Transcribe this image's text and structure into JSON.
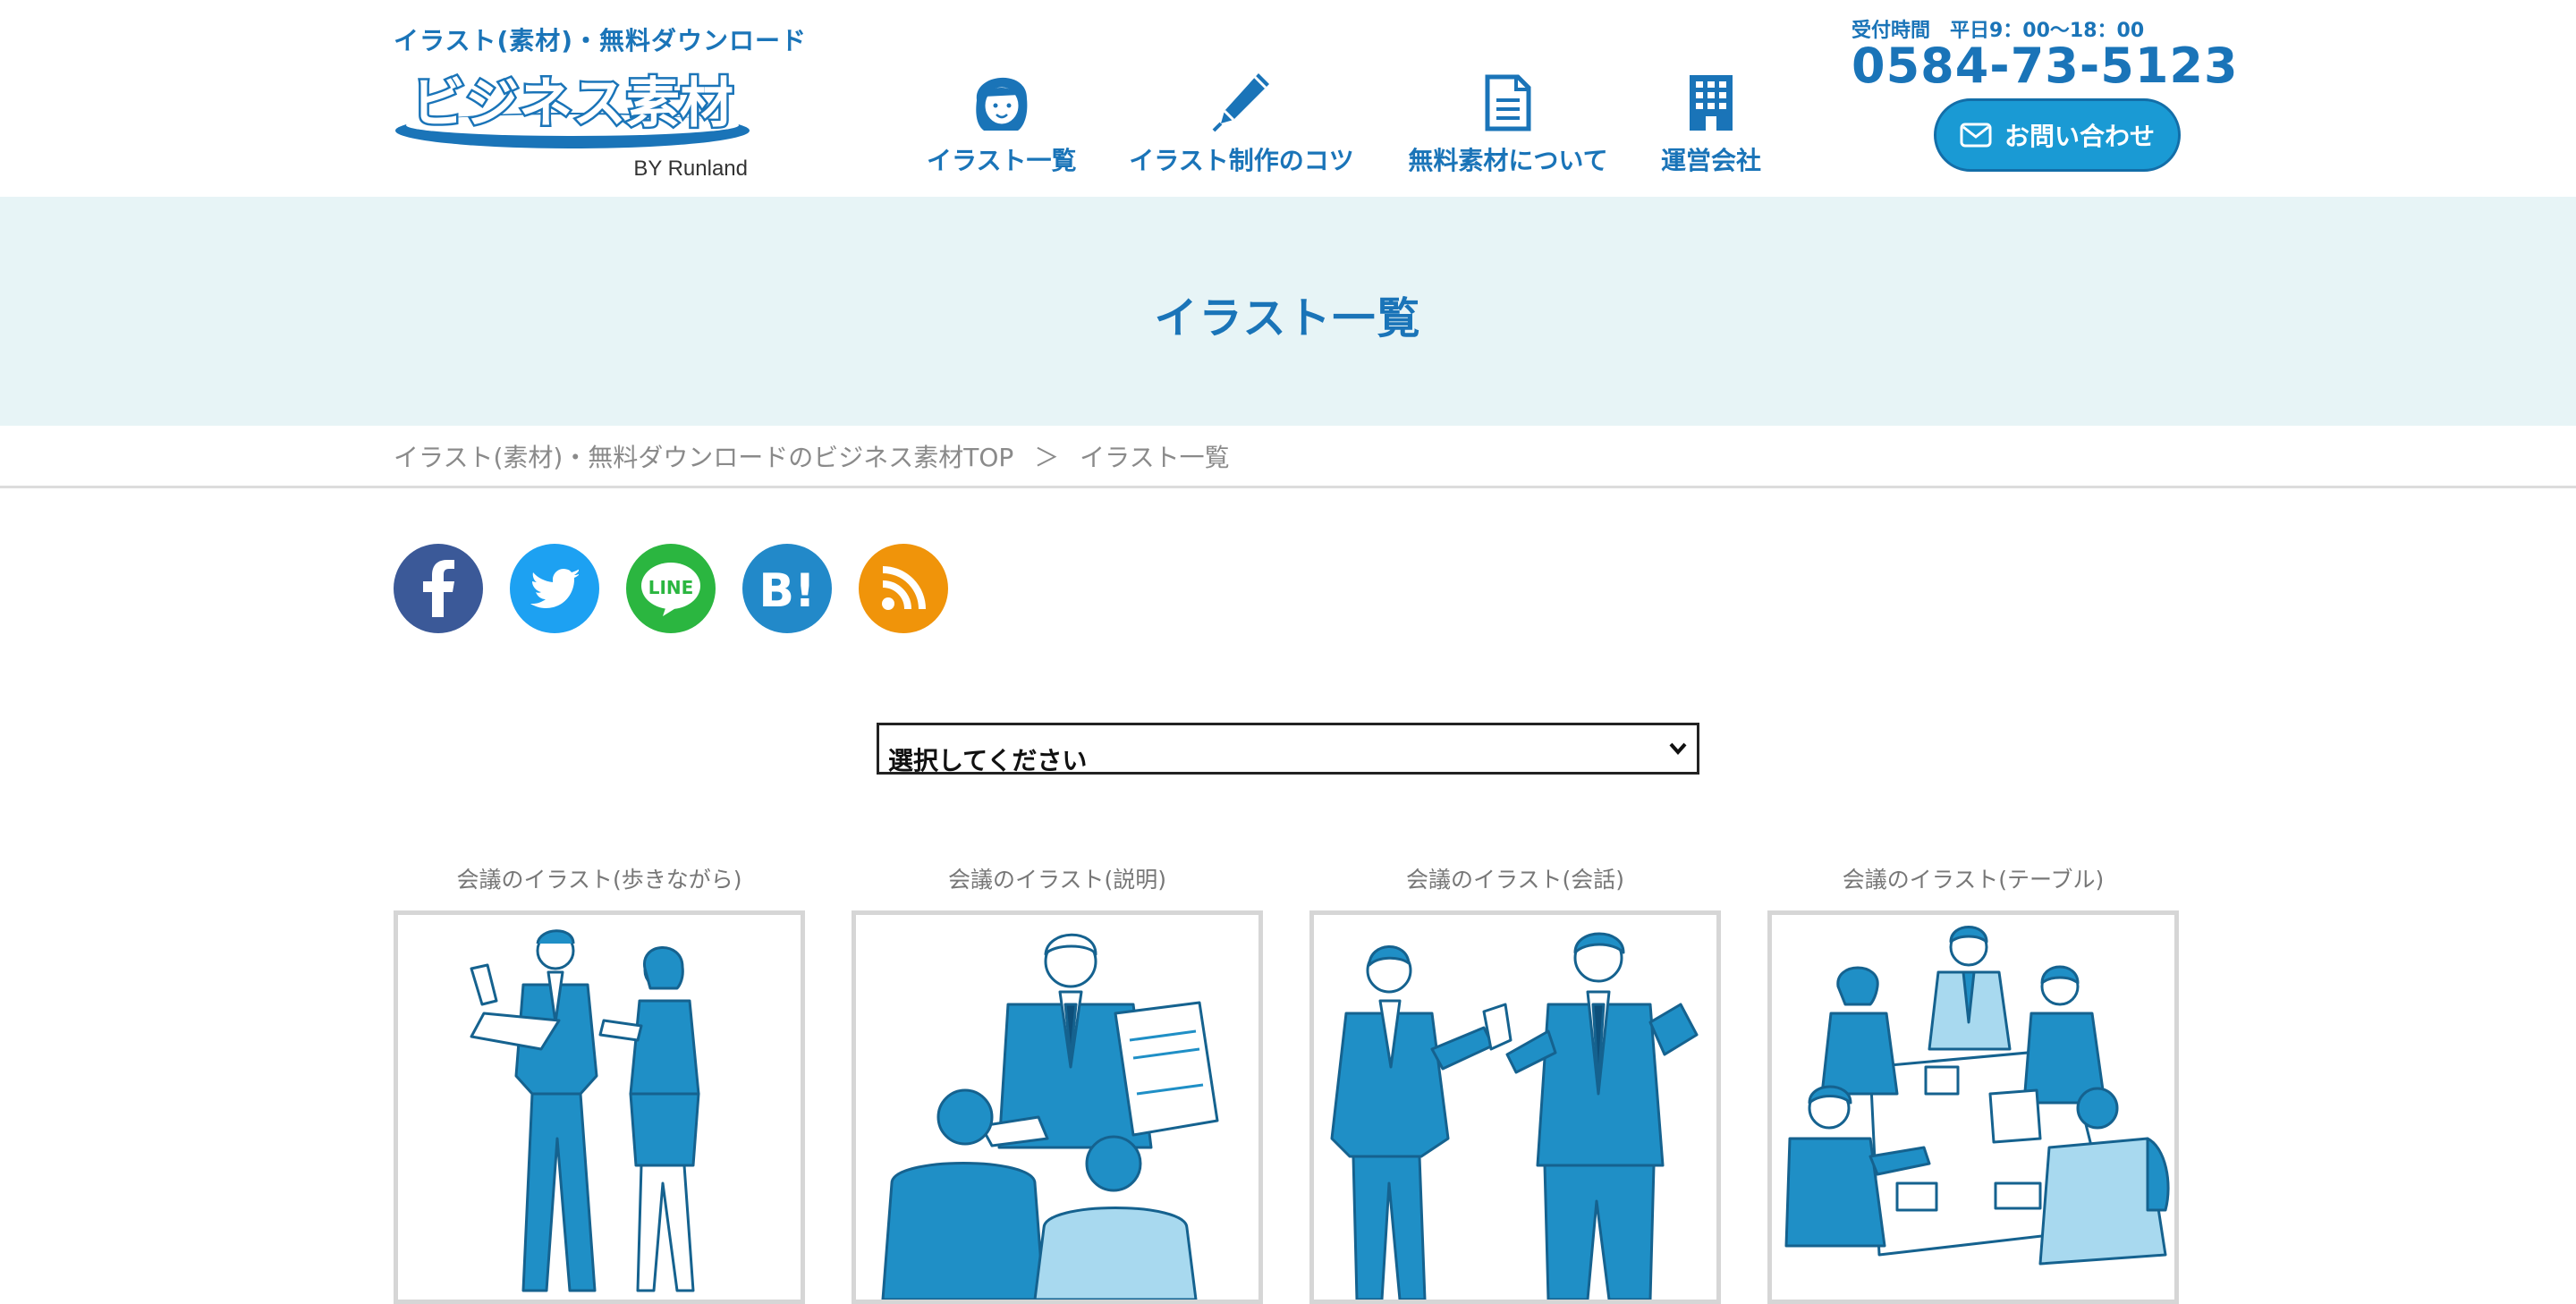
{
  "header": {
    "tagline": "イラスト(素材)・無料ダウンロード",
    "logo_text": "ビジネス素材",
    "logo_sub": "BY Runland",
    "nav": [
      {
        "label": "イラスト一覧",
        "icon": "woman-face-icon"
      },
      {
        "label": "イラスト制作のコツ",
        "icon": "pen-icon"
      },
      {
        "label": "無料素材について",
        "icon": "document-icon"
      },
      {
        "label": "運営会社",
        "icon": "building-icon"
      }
    ],
    "hours": "受付時間　平日9：00〜18：00",
    "phone": "0584-73-5123",
    "contact_label": "お問い合わせ",
    "accent_color": "#1a74b8",
    "button_color": "#1a9ad4"
  },
  "banner": {
    "title": "イラスト一覧",
    "background": "#e7f4f6"
  },
  "breadcrumb": {
    "home": "イラスト(素材)・無料ダウンロードのビジネス素材TOP",
    "separator": "＞",
    "current": "イラスト一覧"
  },
  "share": [
    {
      "name": "facebook",
      "icon": "facebook-icon",
      "color": "#3b5998"
    },
    {
      "name": "twitter",
      "icon": "twitter-icon",
      "color": "#1da1f2"
    },
    {
      "name": "line",
      "icon": "line-icon",
      "color": "#2bb640",
      "text": "LINE"
    },
    {
      "name": "hatena",
      "icon": "hatena-bookmark-icon",
      "color": "#2289c9",
      "text": "B!"
    },
    {
      "name": "rss",
      "icon": "rss-icon",
      "color": "#f0940a"
    }
  ],
  "filter": {
    "selected": "選択してください"
  },
  "cards": [
    {
      "title": "会議のイラスト(歩きながら)"
    },
    {
      "title": "会議のイラスト(説明)"
    },
    {
      "title": "会議のイラスト(会話)"
    },
    {
      "title": "会議のイラスト(テーブル)"
    }
  ]
}
